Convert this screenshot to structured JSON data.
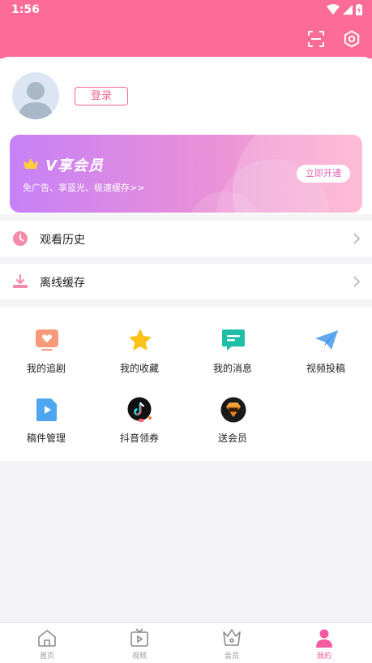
{
  "status_bar": {
    "time": "1:56"
  },
  "profile": {
    "login_label": "登录"
  },
  "vip": {
    "title": "V享会员",
    "subtitle": "免广告、享蓝光、极速缓存>>",
    "open_label": "立即开通"
  },
  "menu": [
    {
      "label": "观看历史",
      "icon": "clock-icon"
    },
    {
      "label": "离线缓存",
      "icon": "download-icon"
    }
  ],
  "tools": [
    {
      "label": "我的追剧",
      "icon": "heart-tv-icon"
    },
    {
      "label": "我的收藏",
      "icon": "star-icon"
    },
    {
      "label": "我的消息",
      "icon": "message-icon"
    },
    {
      "label": "视频投稿",
      "icon": "paper-plane-icon"
    },
    {
      "label": "稿件管理",
      "icon": "video-file-icon"
    },
    {
      "label": "抖音领券",
      "icon": "tiktok-icon"
    },
    {
      "label": "送会员",
      "icon": "gift-diamond-icon"
    }
  ],
  "tabs": [
    {
      "label": "首页",
      "icon": "home-icon",
      "active": false
    },
    {
      "label": "视频",
      "icon": "tv-icon",
      "active": false
    },
    {
      "label": "会员",
      "icon": "crown-icon",
      "active": false
    },
    {
      "label": "我的",
      "icon": "person-icon",
      "active": true
    }
  ],
  "colors": {
    "primary": "#fd6b98",
    "accent_pink": "#f16a93",
    "tab_active": "#f55aa0"
  }
}
